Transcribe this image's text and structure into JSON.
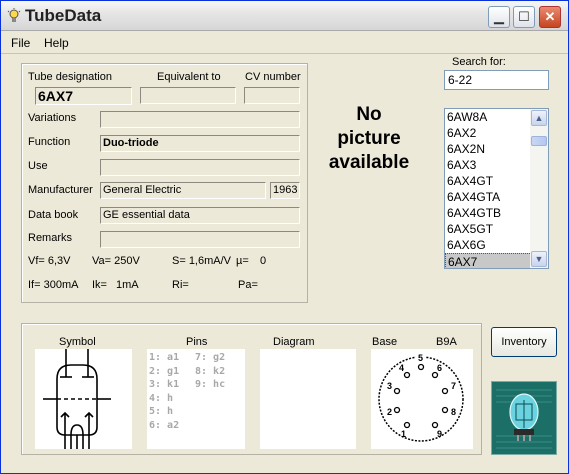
{
  "window": {
    "title": "TubeData"
  },
  "menu": {
    "file": "File",
    "help": "Help"
  },
  "labels": {
    "tube_designation": "Tube designation",
    "equivalent_to": "Equivalent to",
    "cv_number": "CV number",
    "variations": "Variations",
    "function": "Function",
    "use": "Use",
    "manufacturer": "Manufacturer",
    "data_book": "Data book",
    "remarks": "Remarks"
  },
  "fields": {
    "tube_designation": "6AX7",
    "equivalent_to": "",
    "cv_number": "",
    "variations": "",
    "function": "Duo-triode",
    "use": "",
    "manufacturer": "General Electric",
    "year": "1963",
    "data_book": "GE essential data",
    "remarks": ""
  },
  "params": {
    "vf": "Vf= 6,3V",
    "va": "Va= 250V",
    "s": "S= 1,6mA/V",
    "mu": "µ=",
    "mu_value": "0",
    "if": "If= 300mA",
    "ik": "Ik=",
    "ik_value": "1mA",
    "ri": "Ri=",
    "pa": "Pa="
  },
  "picture": {
    "line1": "No",
    "line2": "picture",
    "line3": "available"
  },
  "search": {
    "label": "Search for:",
    "value": "6-22"
  },
  "tube_list": [
    "6AW8A",
    "6AX2",
    "6AX2N",
    "6AX3",
    "6AX4GT",
    "6AX4GTA",
    "6AX4GTB",
    "6AX5GT",
    "6AX6G",
    "6AX7"
  ],
  "selected_tube": "6AX7",
  "bottom": {
    "symbol": "Symbol",
    "pins": "Pins",
    "diagram": "Diagram",
    "base": "Base",
    "base_type": "B9A"
  },
  "pins_left": [
    "1: a1",
    "2: g1",
    "3: k1",
    "4: h",
    "5: h",
    "6: a2"
  ],
  "pins_right": [
    "7: g2",
    "8: k2",
    "9: hc"
  ],
  "base_numbers": [
    "1",
    "2",
    "3",
    "4",
    "5",
    "6",
    "7",
    "8",
    "9"
  ],
  "buttons": {
    "inventory": "Inventory"
  },
  "icons": {
    "app": "lightbulb-icon",
    "minimize": "minimize-icon",
    "maximize": "maximize-icon",
    "close": "close-icon",
    "scroll_up": "chevron-up-icon",
    "scroll_down": "chevron-down-icon"
  }
}
